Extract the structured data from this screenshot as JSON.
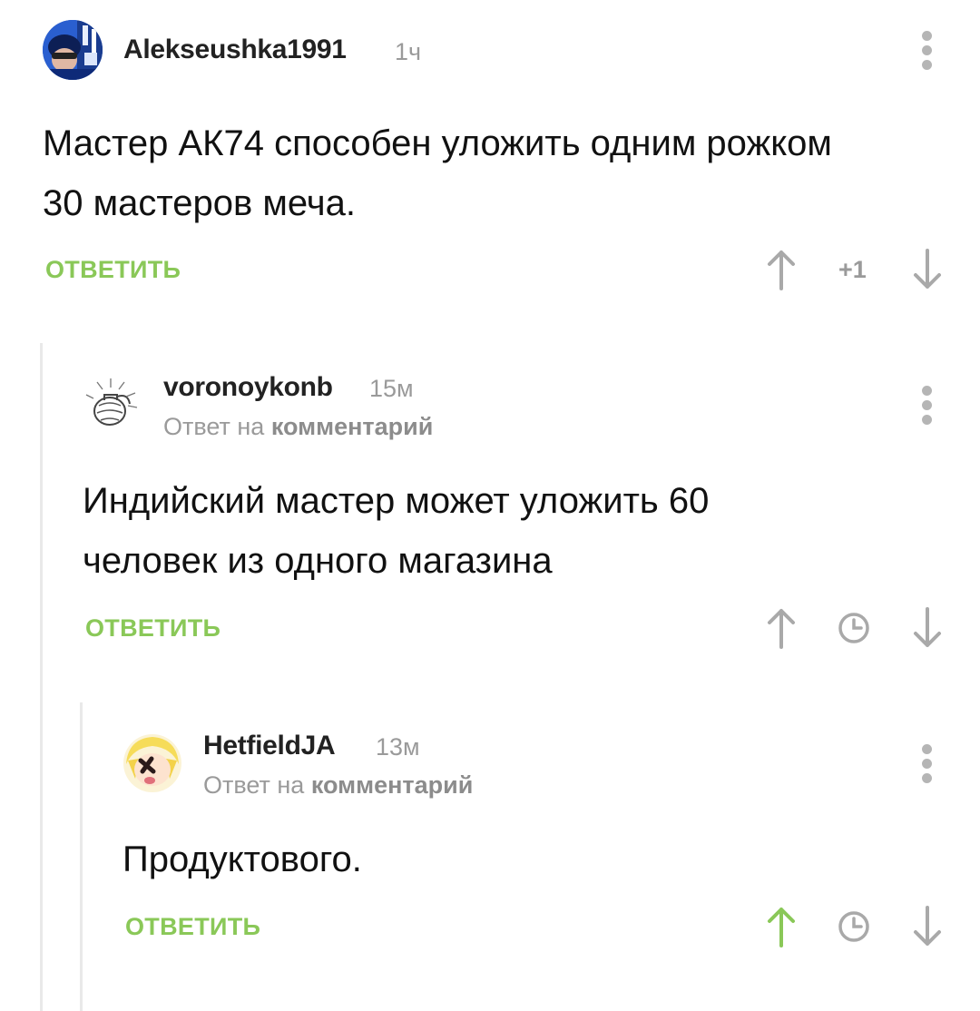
{
  "comments": [
    {
      "username": "Alekseushka1991",
      "time": "1ч",
      "body_lines": [
        "Мастер АК74 способен уложить одним рожком",
        "30 мастеров меча."
      ],
      "reply_label": "ОТВЕТИТЬ",
      "rating": "+1",
      "upvoted": false,
      "avatar_icon": "user-avatar-photo"
    },
    {
      "username": "voronoykonb",
      "time": "15м",
      "reply_prefix": "Ответ на",
      "reply_link": "комментарий",
      "body_lines": [
        "Индийский мастер может уложить 60",
        "человек из одного магазина"
      ],
      "reply_label": "ОТВЕТИТЬ",
      "rating_icon": "clock-icon",
      "upvoted": false,
      "avatar_icon": "grenade-sketch-avatar"
    },
    {
      "username": "HetfieldJA",
      "time": "13м",
      "reply_prefix": "Ответ на",
      "reply_link": "комментарий",
      "body_lines": [
        "Продуктового."
      ],
      "reply_label": "ОТВЕТИТЬ",
      "rating_icon": "clock-icon",
      "upvoted": true,
      "avatar_icon": "anime-character-avatar"
    }
  ],
  "colors": {
    "accent_green": "#8ac858",
    "muted_gray": "#9a9a9a",
    "icon_gray": "#a9a9a9",
    "thread_line": "#e9e9e9"
  }
}
